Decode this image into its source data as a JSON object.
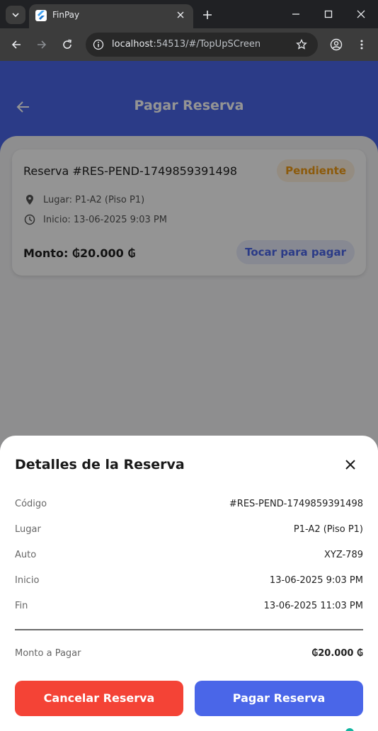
{
  "browser": {
    "tab_title": "FinPay",
    "url_host": "localhost",
    "url_rest": ":54513/#/TopUpSCreen"
  },
  "app": {
    "title": "Pagar Reserva",
    "card": {
      "title": "Reserva #RES-PEND-1749859391498",
      "status": "Pendiente",
      "place": "Lugar: P1-A2 (Piso P1)",
      "start": "Inicio: 13-06-2025 9:03 PM",
      "amount": "Monto: ₲20.000 ₲",
      "tap_to_pay": "Tocar para pagar"
    }
  },
  "modal": {
    "title": "Detalles de la Reserva",
    "rows": [
      {
        "label": "Código",
        "value": "#RES-PEND-1749859391498"
      },
      {
        "label": "Lugar",
        "value": "P1-A2 (Piso P1)"
      },
      {
        "label": "Auto",
        "value": "XYZ-789"
      },
      {
        "label": "Inicio",
        "value": "13-06-2025 9:03 PM"
      },
      {
        "label": "Fin",
        "value": "13-06-2025 11:03 PM"
      }
    ],
    "total_label": "Monto a Pagar",
    "total_value": "₲20.000 ₲",
    "cancel_label": "Cancelar Reserva",
    "pay_label": "Pagar Reserva"
  },
  "colors": {
    "primary": "#4a66e8",
    "danger": "#f44336",
    "pending": "#f29b14"
  }
}
